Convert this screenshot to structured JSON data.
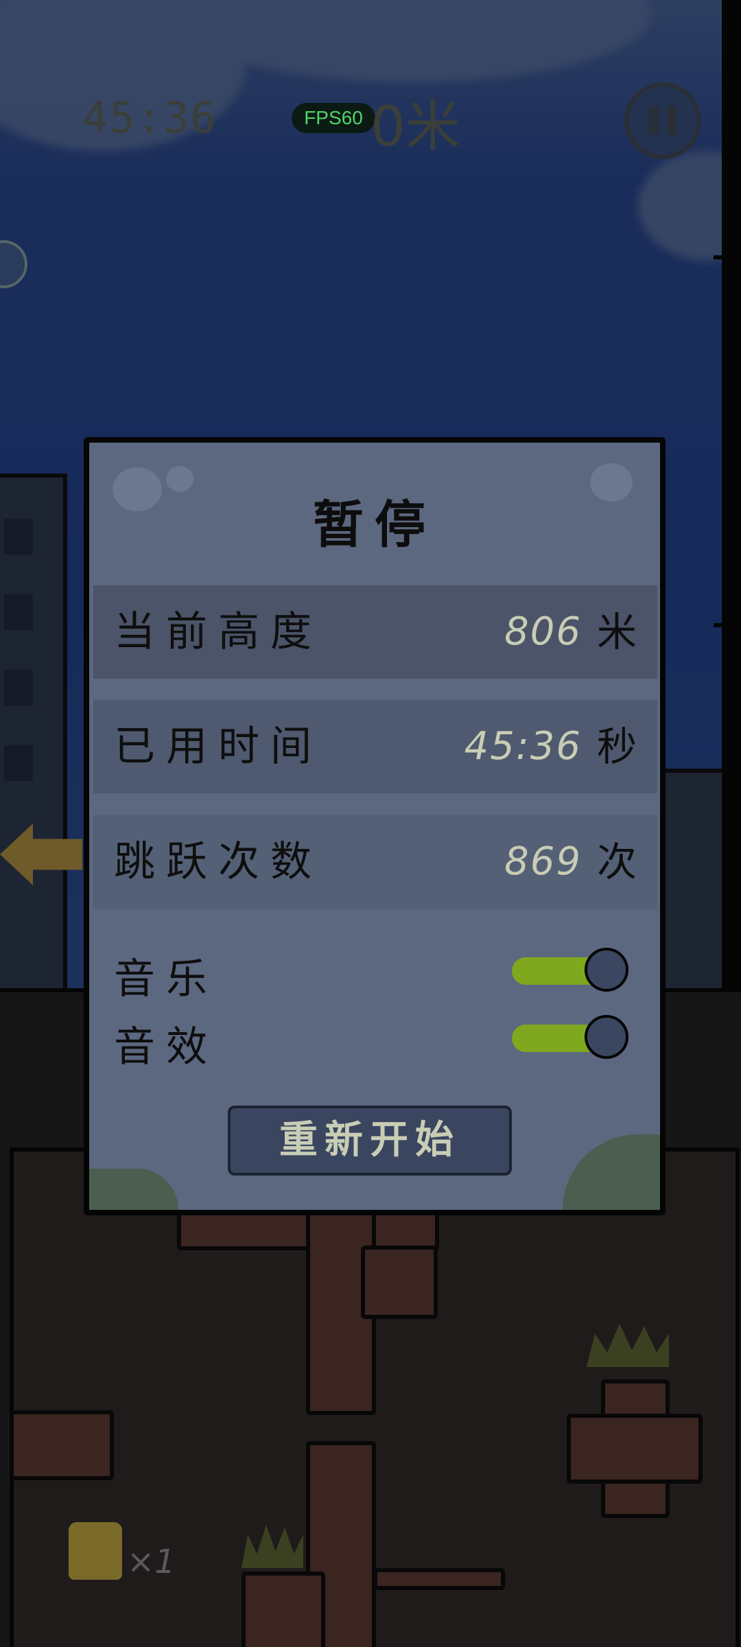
{
  "hud": {
    "elapsed_time": "45:36",
    "height_display": "0米",
    "fps": "FPS60"
  },
  "pause_panel": {
    "title": "暂停",
    "stats": [
      {
        "label": "当前高度",
        "value": "806",
        "unit": "米"
      },
      {
        "label": "已用时间",
        "value": "45:36",
        "unit": "秒"
      },
      {
        "label": "跳跃次数",
        "value": "869",
        "unit": "次"
      }
    ],
    "toggles": [
      {
        "label": "音乐",
        "on": true
      },
      {
        "label": "音效",
        "on": true
      }
    ],
    "restart_label": "重新开始"
  },
  "powerup": {
    "count": "×1"
  },
  "colors": {
    "panel": "#5c6880",
    "toggle_on": "#7fa81f",
    "value_text": "#c8cdb5",
    "fps_text": "#4fd66a"
  }
}
